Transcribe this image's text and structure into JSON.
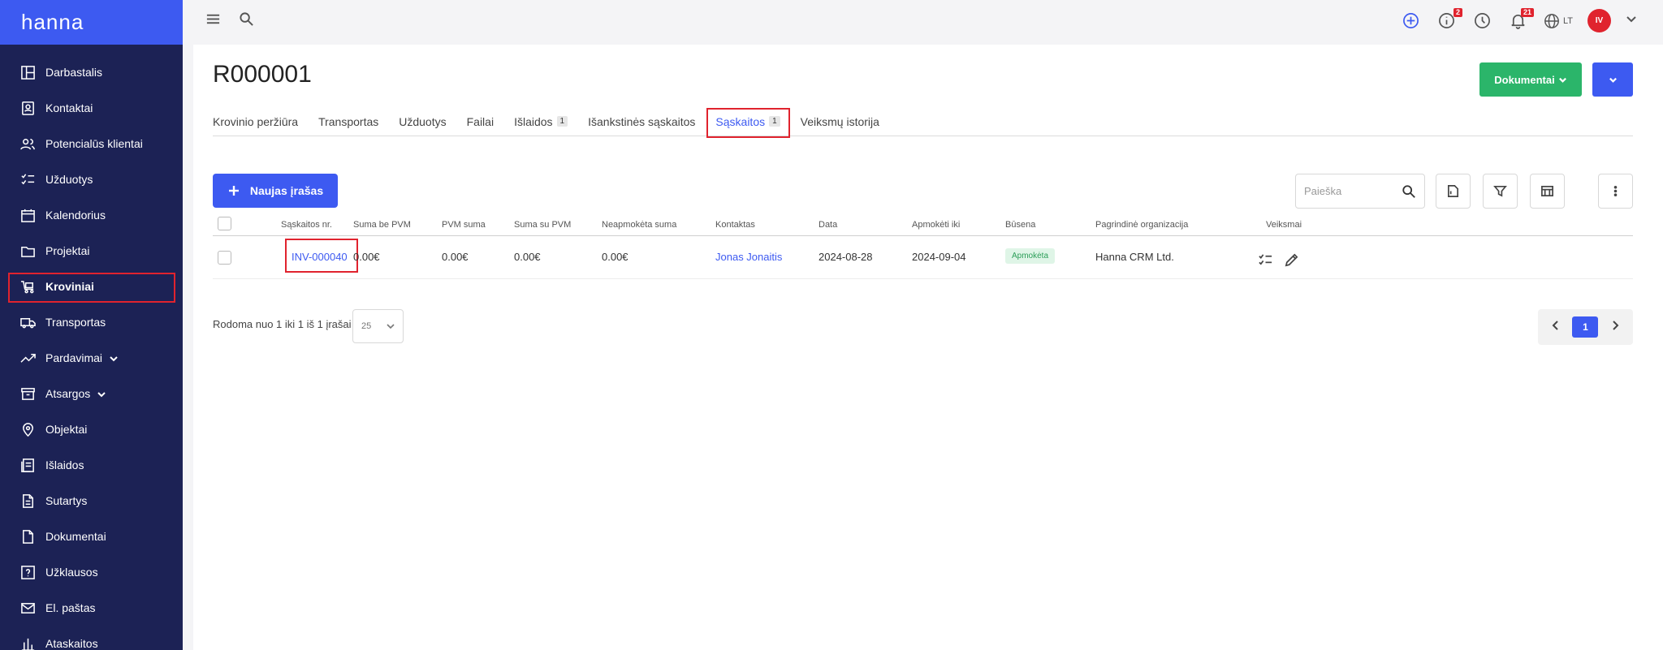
{
  "app": {
    "logo": "hanna"
  },
  "sidebar": {
    "items": [
      {
        "label": "Darbastalis",
        "icon": "dashboard-icon"
      },
      {
        "label": "Kontaktai",
        "icon": "contacts-icon"
      },
      {
        "label": "Potencialūs klientai",
        "icon": "leads-icon"
      },
      {
        "label": "Užduotys",
        "icon": "tasks-icon"
      },
      {
        "label": "Kalendorius",
        "icon": "calendar-icon"
      },
      {
        "label": "Projektai",
        "icon": "folder-icon"
      },
      {
        "label": "Kroviniai",
        "icon": "cargo-icon",
        "active": true
      },
      {
        "label": "Transportas",
        "icon": "truck-icon"
      },
      {
        "label": "Pardavimai",
        "icon": "trend-icon",
        "expandable": true
      },
      {
        "label": "Atsargos",
        "icon": "archive-icon",
        "expandable": true
      },
      {
        "label": "Objektai",
        "icon": "location-icon"
      },
      {
        "label": "Išlaidos",
        "icon": "expenses-icon"
      },
      {
        "label": "Sutartys",
        "icon": "contract-icon"
      },
      {
        "label": "Dokumentai",
        "icon": "documents-icon"
      },
      {
        "label": "Užklausos",
        "icon": "question-icon"
      },
      {
        "label": "El. paštas",
        "icon": "mail-icon"
      },
      {
        "label": "Ataskaitos",
        "icon": "reports-icon"
      }
    ]
  },
  "topbar": {
    "info_badge": "2",
    "notifications_badge": "21",
    "language": "LT",
    "avatar_initials": "IV"
  },
  "page": {
    "title": "R000001",
    "documents_button": "Dokumentai",
    "tabs": [
      {
        "label": "Krovinio peržiūra",
        "count": ""
      },
      {
        "label": "Transportas",
        "count": ""
      },
      {
        "label": "Užduotys",
        "count": ""
      },
      {
        "label": "Failai",
        "count": ""
      },
      {
        "label": "Išlaidos",
        "count": "1"
      },
      {
        "label": "Išankstinės sąskaitos",
        "count": ""
      },
      {
        "label": "Sąskaitos",
        "count": "1",
        "active": true
      },
      {
        "label": "Veiksmų istorija",
        "count": ""
      }
    ],
    "new_button": "Naujas įrašas",
    "search_placeholder": "Paieška"
  },
  "table": {
    "headers": {
      "invoice_no": "Sąskaitos nr.",
      "sum_no_vat": "Suma be PVM",
      "vat_sum": "PVM suma",
      "sum_with_vat": "Suma su PVM",
      "unpaid_sum": "Neapmokėta suma",
      "contact": "Kontaktas",
      "date": "Data",
      "pay_until": "Apmokėti iki",
      "status": "Būsena",
      "organization": "Pagrindinė organizacija",
      "actions": "Veiksmai"
    },
    "rows": [
      {
        "invoice_no": "INV-000040",
        "sum_no_vat": "0.00€",
        "vat_sum": "0.00€",
        "sum_with_vat": "0.00€",
        "unpaid_sum": "0.00€",
        "contact": "Jonas Jonaitis",
        "date": "2024-08-28",
        "pay_until": "2024-09-04",
        "status": "Apmokėta",
        "organization": "Hanna CRM Ltd."
      }
    ]
  },
  "footer": {
    "showing_text": "Rodoma nuo 1 iki 1 iš 1 įrašai",
    "page_size": "25",
    "current_page": "1"
  },
  "colors": {
    "sidebar_bg": "#1c2255",
    "accent": "#3d5af1",
    "success": "#2bb56a",
    "highlight": "#e0232e"
  }
}
